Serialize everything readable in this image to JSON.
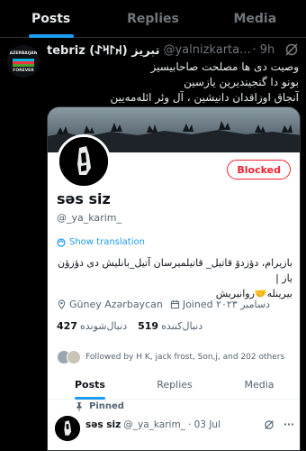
{
  "tabs": [
    {
      "label": "Posts"
    },
    {
      "label": "Replies"
    },
    {
      "label": "Media"
    }
  ],
  "post": {
    "avatar_text_top": "AZERBAIJAN",
    "avatar_text_bottom": "FOREVER",
    "author_name": "tebriz (𐰴𐰃𐰺𐰀) تبریز",
    "handle": "@yalnizkarta...",
    "time": "· 9h",
    "lines": [
      "وصیت دی ها مصلحت صاحابیسیز",
      "بونو دا گنجیندیرین یازسین",
      "آنجاق اوزاقدان دانیشین ، آل وئر ائله‌مه‌یین"
    ]
  },
  "profile": {
    "blocked_label": "Blocked",
    "display_name": "səs siz",
    "handle": "@_ya_karim_",
    "show_translation": "Show translation",
    "bio_line1": "بازیرام، دؤزدۆ قاتیل_ قاتیلمیرسان آتیل_بانلیش دی دؤزؤن یاز |",
    "bio_line2": "بیرینله🤝روانیریش",
    "location": "Güney Azərbaycan",
    "joined": "Joined ۲۰۲۳ دسامبر",
    "following_count": "427",
    "following_label": "دنبال‌شونده",
    "followers_count": "519",
    "followers_label": "دنبال‌کننده",
    "followed_by": "Followed by H K, jack frost, Son,j, and 202 others"
  },
  "profile_tabs": [
    {
      "label": "Posts"
    },
    {
      "label": "Replies"
    },
    {
      "label": "Media"
    }
  ],
  "pinned": {
    "label": "Pinned",
    "name": "səs siz",
    "handle": "@_ya_karim_",
    "date": "· 03 Jul",
    "more": "···"
  },
  "colors": {
    "accent": "#1d9bf0",
    "blocked": "#f4212e"
  },
  "icons": [
    "grok-icon",
    "translate-icon",
    "location-icon",
    "calendar-icon",
    "pin-icon",
    "more-icon"
  ]
}
